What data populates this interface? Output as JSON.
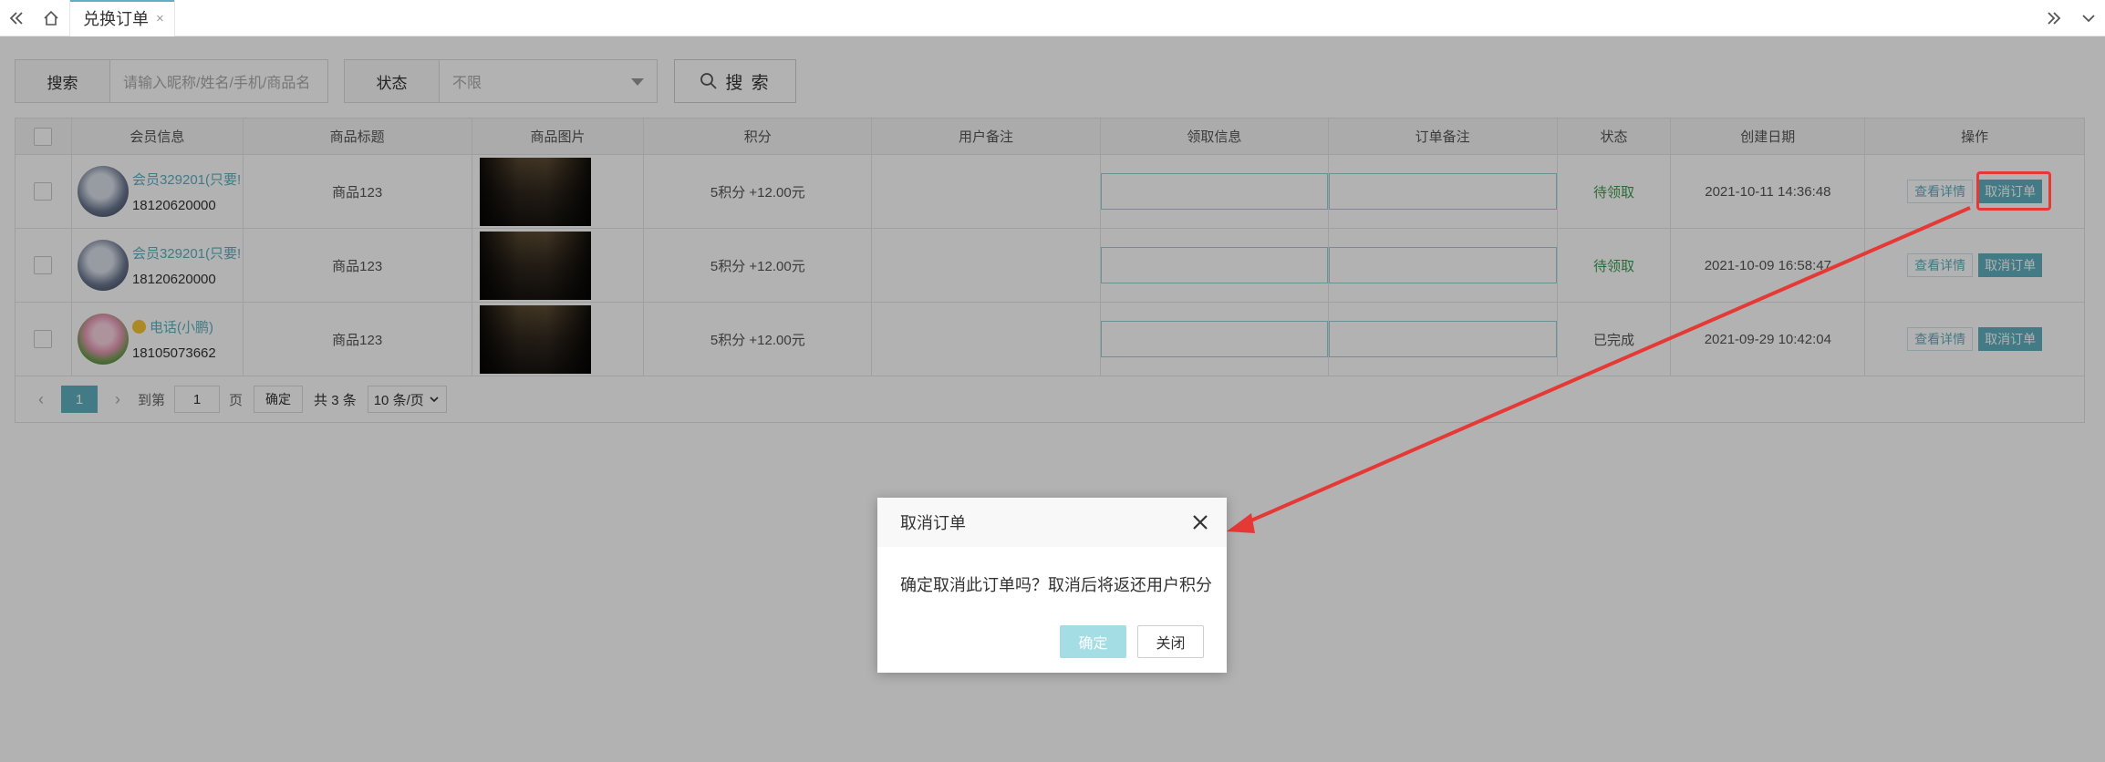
{
  "tabs": {
    "active_label": "兑换订单",
    "close_glyph": "×"
  },
  "search": {
    "keyword_label": "搜索",
    "keyword_placeholder": "请输入昵称/姓名/手机/商品名",
    "status_label": "状态",
    "status_value": "不限",
    "button_label": "搜 索"
  },
  "table": {
    "headers": [
      "会员信息",
      "商品标题",
      "商品图片",
      "积分",
      "用户备注",
      "领取信息",
      "订单备注",
      "状态",
      "创建日期",
      "操作"
    ],
    "rows": [
      {
        "member_name": "会员329201(只要!",
        "phone": "18120620000",
        "title": "商品123",
        "points": "5积分 +12.00元",
        "status": "待领取",
        "date": "2021-10-11 14:36:48",
        "view": "查看详情",
        "cancel": "取消订单"
      },
      {
        "member_name": "会员329201(只要!",
        "phone": "18120620000",
        "title": "商品123",
        "points": "5积分 +12.00元",
        "status": "待领取",
        "date": "2021-10-09 16:58:47",
        "view": "查看详情",
        "cancel": "取消订单"
      },
      {
        "member_name": "电话(小鹏)",
        "phone": "18105073662",
        "title": "商品123",
        "points": "5积分 +12.00元",
        "status": "已完成",
        "date": "2021-09-29 10:42:04",
        "view": "查看详情",
        "cancel": "取消订单"
      }
    ]
  },
  "pager": {
    "current": "1",
    "goto_prefix": "到第",
    "goto_value": "1",
    "goto_suffix": "页",
    "confirm": "确定",
    "total": "共 3 条",
    "page_size": "10 条/页"
  },
  "dialog": {
    "title": "取消订单",
    "message": "确定取消此订单吗？取消后将返还用户积分",
    "ok": "确定",
    "close": "关闭"
  },
  "colors": {
    "accent": "#5fb0c0",
    "status_wait": "#3d9b51",
    "annotation": "#e53935"
  },
  "icons": [
    "double-left-icon",
    "home-icon",
    "double-right-icon",
    "chevron-down-icon",
    "search-icon",
    "close-icon"
  ]
}
